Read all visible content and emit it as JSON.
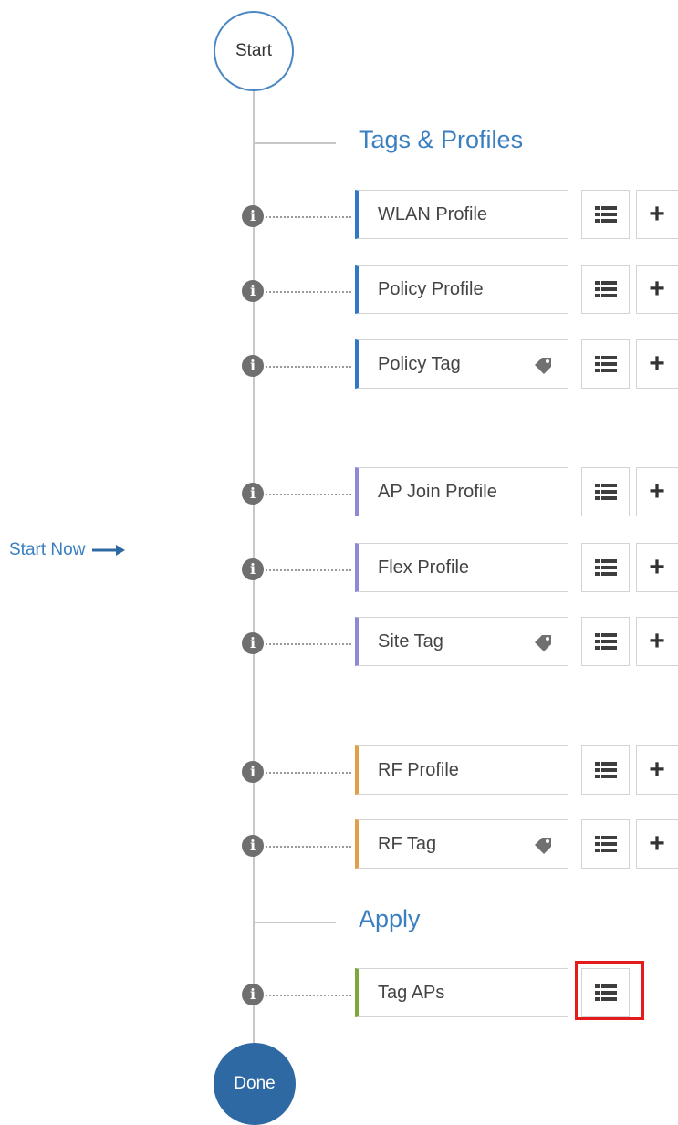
{
  "flow": {
    "start_label": "Start",
    "done_label": "Done",
    "start_now_label": "Start Now"
  },
  "sections": {
    "tags_profiles": "Tags & Profiles",
    "apply": "Apply"
  },
  "items": [
    {
      "label": "WLAN Profile",
      "accent": "#2f78c8",
      "has_tag_icon": false
    },
    {
      "label": "Policy Profile",
      "accent": "#2f78c8",
      "has_tag_icon": false
    },
    {
      "label": "Policy Tag",
      "accent": "#2f78c8",
      "has_tag_icon": true
    },
    {
      "label": "AP Join Profile",
      "accent": "#8c8ad6",
      "has_tag_icon": false
    },
    {
      "label": "Flex Profile",
      "accent": "#8c8ad6",
      "has_tag_icon": false
    },
    {
      "label": "Site Tag",
      "accent": "#8c8ad6",
      "has_tag_icon": true
    },
    {
      "label": "RF Profile",
      "accent": "#e0a046",
      "has_tag_icon": false
    },
    {
      "label": "RF Tag",
      "accent": "#e0a046",
      "has_tag_icon": true
    },
    {
      "label": "Tag APs",
      "accent": "#7aa83a",
      "has_tag_icon": false
    }
  ],
  "icons": {
    "info": "info-icon",
    "list": "list-icon",
    "add": "plus-icon",
    "tag": "tag-icon",
    "arrow": "arrow-right-icon"
  },
  "colors": {
    "link_blue": "#3a7fc0",
    "done_fill": "#2f69a4",
    "highlight": "#e31b1b"
  }
}
